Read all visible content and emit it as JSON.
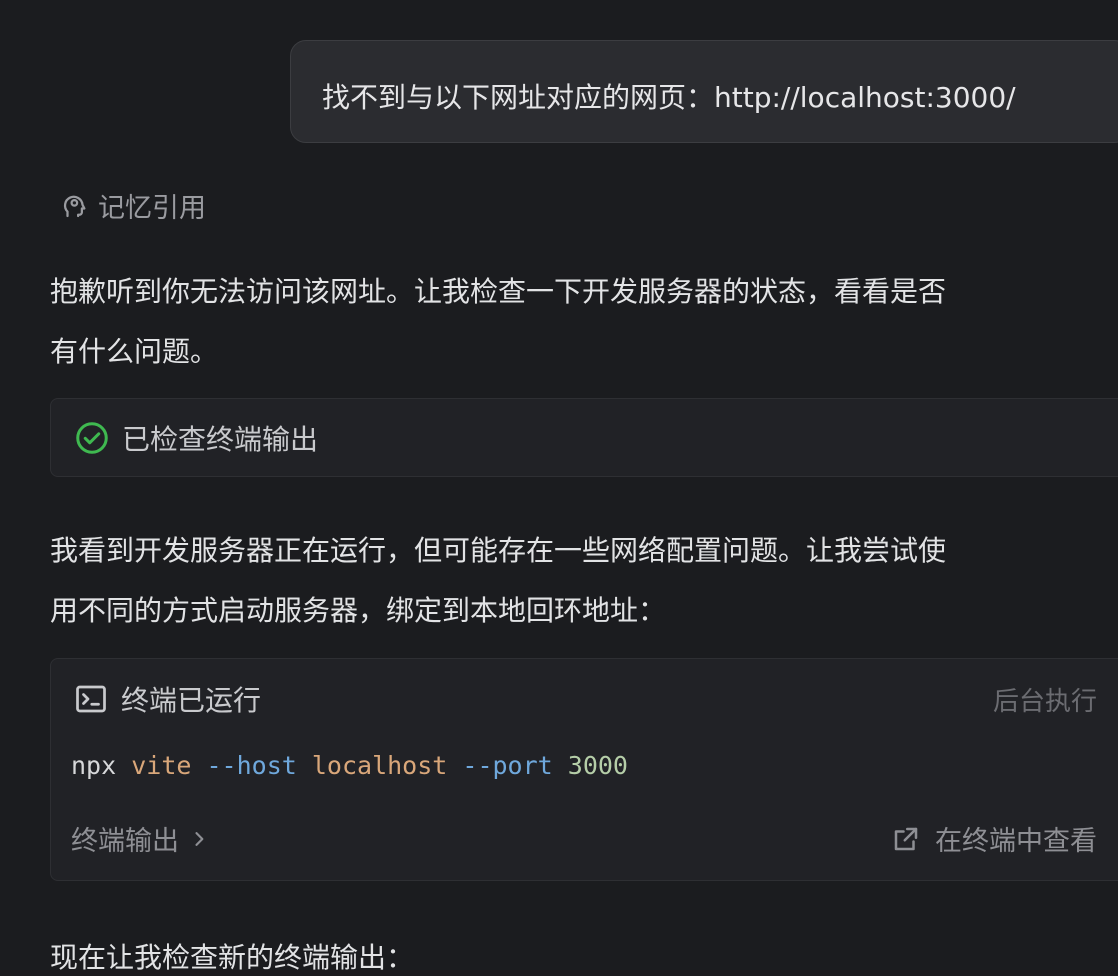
{
  "user_message": {
    "text": "找不到与以下网址对应的网页：http://localhost:3000/"
  },
  "memory_reference": {
    "icon": "brain-head-icon",
    "label": "记忆引用"
  },
  "assistant": {
    "paragraph1_line1": "抱歉听到你无法访问该网址。让我检查一下开发服务器的状态，看看是否",
    "paragraph1_line2": "有什么问题。",
    "checked_step": {
      "icon": "check-circle-icon",
      "label": "已检查终端输出",
      "icon_color": "#3fb950"
    },
    "paragraph2_line1": "我看到开发服务器正在运行，但可能存在一些网络配置问题。让我尝试使",
    "paragraph2_line2": "用不同的方式启动服务器，绑定到本地回环地址：",
    "terminal": {
      "icon": "terminal-icon",
      "title": "终端已运行",
      "background_label": "后台执行",
      "command": {
        "cmd": "npx",
        "tool": "vite",
        "flag1": "--host",
        "value1": "localhost",
        "flag2": "--port",
        "value2": "3000"
      },
      "output_link": "终端输出",
      "view_link": "在终端中查看"
    },
    "paragraph3": "现在让我检查新的终端输出："
  }
}
